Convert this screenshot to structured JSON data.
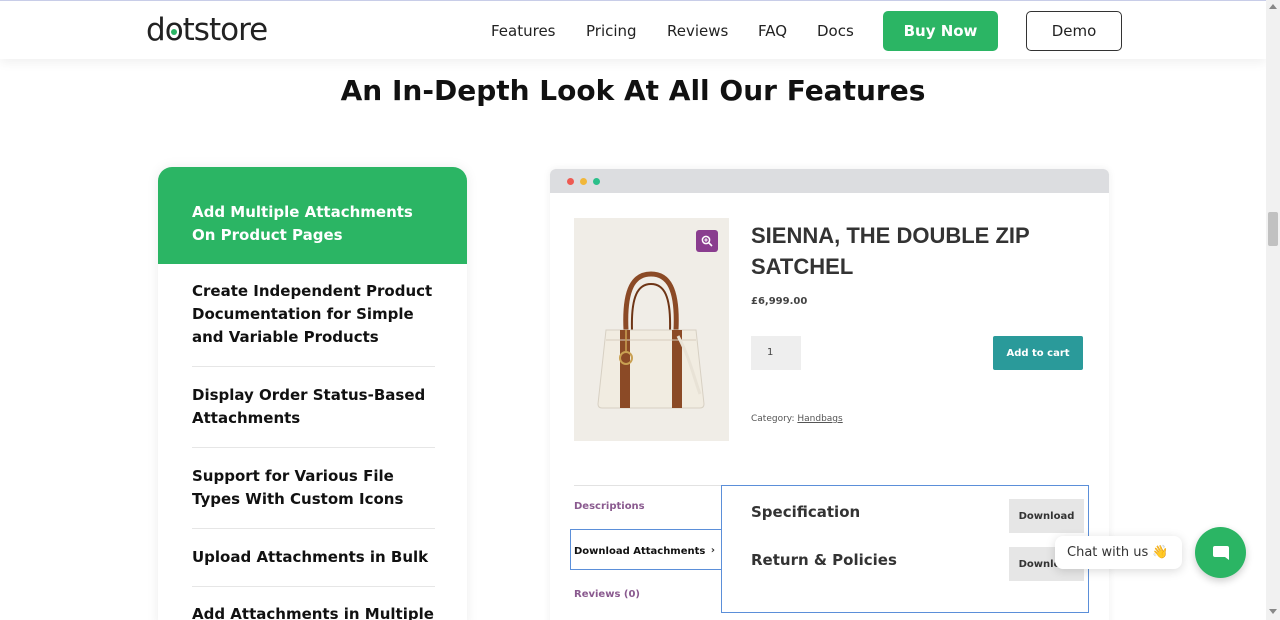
{
  "header": {
    "logo": "dotstore",
    "nav": [
      "Features",
      "Pricing",
      "Reviews",
      "FAQ",
      "Docs"
    ],
    "buy_label": "Buy Now",
    "demo_label": "Demo"
  },
  "section": {
    "title": "An In-Depth Look At All Our Features"
  },
  "features": {
    "active": "Add Multiple Attachments On Product Pages",
    "items": [
      "Create Independent Product Documentation for Simple and Variable Products",
      "Display Order Status-Based Attachments",
      "Support for Various File Types With Custom Icons",
      "Upload Attachments in Bulk",
      "Add Attachments in Multiple"
    ]
  },
  "product": {
    "title": "SIENNA, THE DOUBLE ZIP SATCHEL",
    "price": "£6,999.00",
    "quantity": "1",
    "add_to_cart": "Add to cart",
    "category_label": "Category:",
    "category_link": "Handbags",
    "tabs": {
      "descriptions": "Descriptions",
      "download": "Download Attachments",
      "reviews": "Reviews (0)"
    },
    "downloads": [
      {
        "label": "Specification",
        "button": "Download"
      },
      {
        "label": "Return & Policies",
        "button": "Download"
      }
    ]
  },
  "chat": {
    "text": "Chat with us 👋"
  },
  "colors": {
    "brand_green": "#2bb564",
    "cart_teal": "#2a9a9a",
    "tab_purple": "#8a5a8f",
    "focus_blue": "#5b8fd9"
  },
  "icons": [
    "magnifier-plus-icon",
    "chevron-right-icon",
    "chat-icon",
    "handbag-image"
  ]
}
